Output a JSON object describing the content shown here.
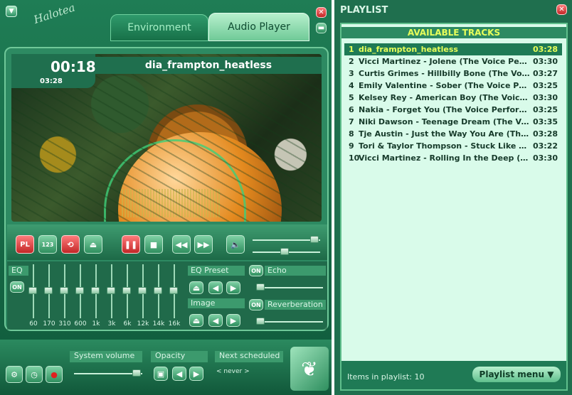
{
  "app": {
    "logo": "Halotea"
  },
  "tabs": {
    "environment": "Environment",
    "audio_player": "Audio Player"
  },
  "player": {
    "elapsed": "00:18",
    "duration": "03:28",
    "now_playing": "dia_frampton_heatless",
    "controls": {
      "pl": "PL",
      "repeat": "123"
    }
  },
  "eq": {
    "label": "EQ",
    "on_label": "ON",
    "bands": [
      "60",
      "170",
      "310",
      "600",
      "1k",
      "3k",
      "6k",
      "12k",
      "14k",
      "16k"
    ],
    "preset_label": "EQ Preset",
    "image_label": "Image"
  },
  "effects": {
    "echo_label": "Echo",
    "echo_on": "ON",
    "reverb_label": "Reverberation",
    "reverb_on": "ON"
  },
  "bottom": {
    "system_volume_label": "System volume",
    "opacity_label": "Opacity",
    "next_scheduled_label": "Next scheduled",
    "next_scheduled_value": "< never >"
  },
  "playlist": {
    "title": "PLAYLIST",
    "header": "AVAILABLE TRACKS",
    "items_count_text": "Items in playlist: 10",
    "menu_label": "Playlist menu",
    "tracks": [
      {
        "n": "1",
        "title": "dia_frampton_heatless",
        "dur": "03:28"
      },
      {
        "n": "2",
        "title": "Vicci Martinez - Jolene (The Voice Perfor...",
        "dur": "03:30"
      },
      {
        "n": "3",
        "title": "Curtis Grimes - Hillbilly Bone (The Voice...",
        "dur": "03:27"
      },
      {
        "n": "4",
        "title": "Emily Valentine - Sober (The Voice Perfo...",
        "dur": "03:25"
      },
      {
        "n": "5",
        "title": "Kelsey Rey - American Boy (The Voice Pe...",
        "dur": "03:30"
      },
      {
        "n": "6",
        "title": "Nakia - Forget You (The Voice Performan...",
        "dur": "03:25"
      },
      {
        "n": "7",
        "title": "Niki Dawson - Teenage Dream (The Voice...",
        "dur": "03:35"
      },
      {
        "n": "8",
        "title": "Tje Austin - Just the Way You Are (The V...",
        "dur": "03:28"
      },
      {
        "n": "9",
        "title": "Tori & Taylor Thompson - Stuck Like Glue...",
        "dur": "03:22"
      },
      {
        "n": "10",
        "title": "Vicci Martinez - Rolling In the Deep (Th...",
        "dur": "03:30"
      }
    ]
  }
}
